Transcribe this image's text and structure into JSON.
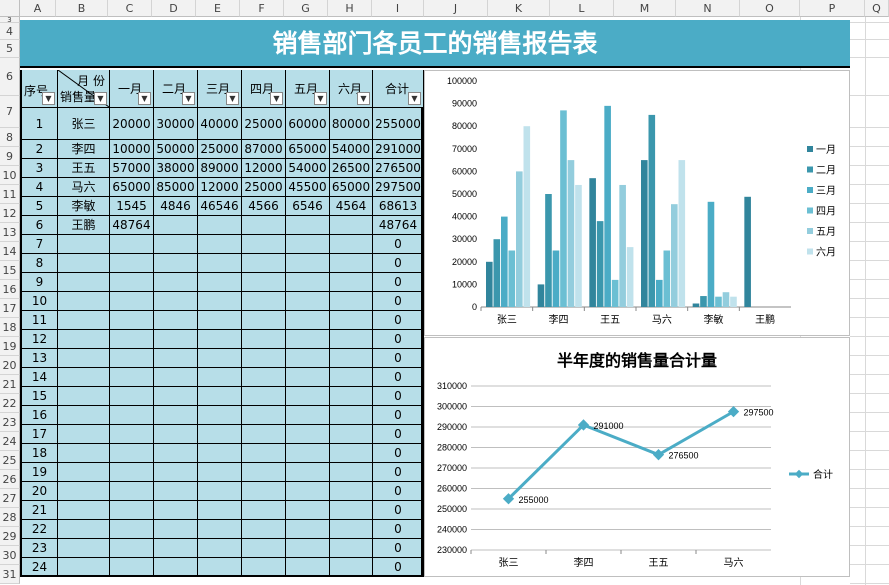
{
  "columns": [
    "A",
    "B",
    "C",
    "D",
    "E",
    "F",
    "G",
    "H",
    "I",
    "J",
    "K",
    "L",
    "M",
    "N",
    "O",
    "P",
    "Q"
  ],
  "rows": [
    "3",
    "4",
    "5",
    "6",
    "7",
    "8",
    "9",
    "10",
    "11",
    "12",
    "13",
    "14",
    "15",
    "16",
    "17",
    "18",
    "19",
    "20",
    "21",
    "22",
    "23",
    "24",
    "25",
    "26",
    "27",
    "28",
    "29",
    "30",
    "31"
  ],
  "report_title": "销售部门各员工的销售报告表",
  "header": {
    "seq": "序号",
    "month_label": "月 份",
    "sales_label": "销售量",
    "months": [
      "一月",
      "二月",
      "三月",
      "四月",
      "五月",
      "六月"
    ],
    "total": "合计"
  },
  "data_rows": [
    {
      "seq": "1",
      "name": "张三",
      "vals": [
        "20000",
        "30000",
        "40000",
        "25000",
        "60000",
        "80000"
      ],
      "total": "255000"
    },
    {
      "seq": "2",
      "name": "李四",
      "vals": [
        "10000",
        "50000",
        "25000",
        "87000",
        "65000",
        "54000"
      ],
      "total": "291000"
    },
    {
      "seq": "3",
      "name": "王五",
      "vals": [
        "57000",
        "38000",
        "89000",
        "12000",
        "54000",
        "26500"
      ],
      "total": "276500"
    },
    {
      "seq": "4",
      "name": "马六",
      "vals": [
        "65000",
        "85000",
        "12000",
        "25000",
        "45500",
        "65000"
      ],
      "total": "297500"
    },
    {
      "seq": "5",
      "name": "李敏",
      "vals": [
        "1545",
        "4846",
        "46546",
        "4566",
        "6546",
        "4564"
      ],
      "total": "68613"
    },
    {
      "seq": "6",
      "name": "王鹏",
      "vals": [
        "48764",
        "",
        "",
        "",
        "",
        "",
        ""
      ],
      "total": "48764"
    },
    {
      "seq": "7",
      "name": "",
      "vals": [
        "",
        "",
        "",
        "",
        "",
        ""
      ],
      "total": "0"
    },
    {
      "seq": "8",
      "name": "",
      "vals": [
        "",
        "",
        "",
        "",
        "",
        ""
      ],
      "total": "0"
    },
    {
      "seq": "9",
      "name": "",
      "vals": [
        "",
        "",
        "",
        "",
        "",
        ""
      ],
      "total": "0"
    },
    {
      "seq": "10",
      "name": "",
      "vals": [
        "",
        "",
        "",
        "",
        "",
        ""
      ],
      "total": "0"
    },
    {
      "seq": "11",
      "name": "",
      "vals": [
        "",
        "",
        "",
        "",
        "",
        ""
      ],
      "total": "0"
    },
    {
      "seq": "12",
      "name": "",
      "vals": [
        "",
        "",
        "",
        "",
        "",
        ""
      ],
      "total": "0"
    },
    {
      "seq": "13",
      "name": "",
      "vals": [
        "",
        "",
        "",
        "",
        "",
        ""
      ],
      "total": "0"
    },
    {
      "seq": "14",
      "name": "",
      "vals": [
        "",
        "",
        "",
        "",
        "",
        ""
      ],
      "total": "0"
    },
    {
      "seq": "15",
      "name": "",
      "vals": [
        "",
        "",
        "",
        "",
        "",
        ""
      ],
      "total": "0"
    },
    {
      "seq": "16",
      "name": "",
      "vals": [
        "",
        "",
        "",
        "",
        "",
        ""
      ],
      "total": "0"
    },
    {
      "seq": "17",
      "name": "",
      "vals": [
        "",
        "",
        "",
        "",
        "",
        ""
      ],
      "total": "0"
    },
    {
      "seq": "18",
      "name": "",
      "vals": [
        "",
        "",
        "",
        "",
        "",
        ""
      ],
      "total": "0"
    },
    {
      "seq": "19",
      "name": "",
      "vals": [
        "",
        "",
        "",
        "",
        "",
        ""
      ],
      "total": "0"
    },
    {
      "seq": "20",
      "name": "",
      "vals": [
        "",
        "",
        "",
        "",
        "",
        ""
      ],
      "total": "0"
    },
    {
      "seq": "21",
      "name": "",
      "vals": [
        "",
        "",
        "",
        "",
        "",
        ""
      ],
      "total": "0"
    },
    {
      "seq": "22",
      "name": "",
      "vals": [
        "",
        "",
        "",
        "",
        "",
        ""
      ],
      "total": "0"
    },
    {
      "seq": "23",
      "name": "",
      "vals": [
        "",
        "",
        "",
        "",
        "",
        ""
      ],
      "total": "0"
    },
    {
      "seq": "24",
      "name": "",
      "vals": [
        "",
        "",
        "",
        "",
        "",
        ""
      ],
      "total": "0"
    }
  ],
  "chart_data": [
    {
      "type": "bar",
      "title": "",
      "categories": [
        "张三",
        "李四",
        "王五",
        "马六",
        "李敏",
        "王鹏"
      ],
      "series": [
        {
          "name": "一月",
          "values": [
            20000,
            10000,
            57000,
            65000,
            1545,
            48764
          ],
          "color": "#31859c"
        },
        {
          "name": "二月",
          "values": [
            30000,
            50000,
            38000,
            85000,
            4846,
            0
          ],
          "color": "#3b97ad"
        },
        {
          "name": "三月",
          "values": [
            40000,
            25000,
            89000,
            12000,
            46546,
            0
          ],
          "color": "#4bacc6"
        },
        {
          "name": "四月",
          "values": [
            25000,
            87000,
            12000,
            25000,
            4566,
            0
          ],
          "color": "#6bbfd3"
        },
        {
          "name": "五月",
          "values": [
            60000,
            65000,
            54000,
            45500,
            6546,
            0
          ],
          "color": "#93cddd"
        },
        {
          "name": "六月",
          "values": [
            80000,
            54000,
            26500,
            65000,
            4564,
            0
          ],
          "color": "#c0e2ec"
        }
      ],
      "ylim": [
        0,
        100000
      ],
      "yticks": [
        "0",
        "10000",
        "20000",
        "30000",
        "40000",
        "50000",
        "60000",
        "70000",
        "80000",
        "90000",
        "100000"
      ],
      "legend": "right",
      "grid": false
    },
    {
      "type": "line",
      "title": "半年度的销售量合计量",
      "categories": [
        "张三",
        "李四",
        "王五",
        "马六"
      ],
      "series": [
        {
          "name": "合计",
          "values": [
            255000,
            291000,
            276500,
            297500
          ],
          "color": "#4bacc6"
        }
      ],
      "data_labels": [
        "255000",
        "291000",
        "276500",
        "297500"
      ],
      "ylim": [
        230000,
        310000
      ],
      "yticks": [
        "230000",
        "240000",
        "250000",
        "260000",
        "270000",
        "280000",
        "290000",
        "300000",
        "310000"
      ],
      "legend": "right",
      "grid": true
    }
  ]
}
